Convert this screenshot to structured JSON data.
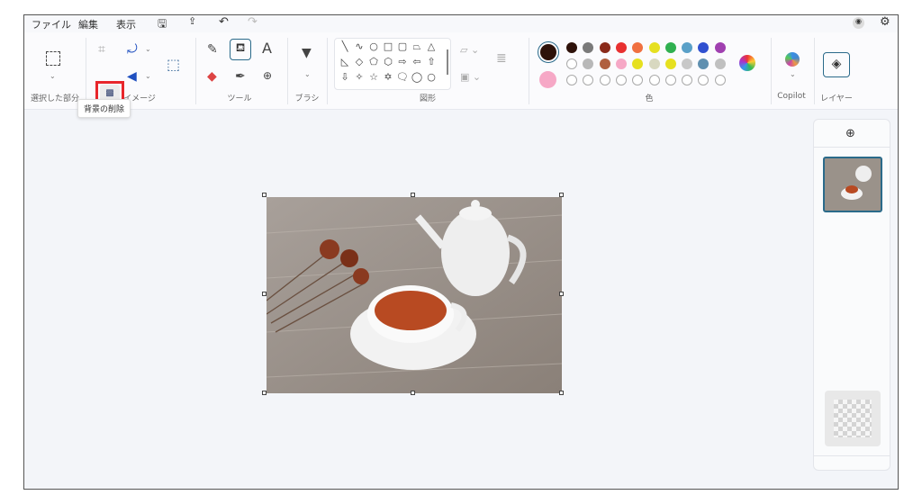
{
  "menu": {
    "file": "ファイル",
    "edit": "編集",
    "view": "表示"
  },
  "ribbon": {
    "groups": {
      "selection": "選択した部分",
      "image": "イメージ",
      "tools": "ツール",
      "brush": "ブラシ",
      "shapes": "図形",
      "colors": "色",
      "copilot": "Copilot",
      "layers": "レイヤー"
    },
    "tooltip": "背景の削除",
    "tool_text": "A"
  },
  "colors": {
    "primary": "#2e120a",
    "secondary": "#f6a8c6",
    "row1": [
      "#2e120a",
      "#7a7a7a",
      "#8a2a1a",
      "#e83030",
      "#f07040",
      "#e6e020",
      "#30b050",
      "#5aa0c8",
      "#3050d0",
      "#a040b0"
    ],
    "row2": [
      "#ffffff",
      "#b8b8b8",
      "#b06040",
      "#f6a8c6",
      "#e6e020",
      "#d8d8c0",
      "#e6e020",
      "#c8c8c8",
      "#6090b0",
      "#c0c0c0"
    ],
    "accent": "#e8262b"
  }
}
